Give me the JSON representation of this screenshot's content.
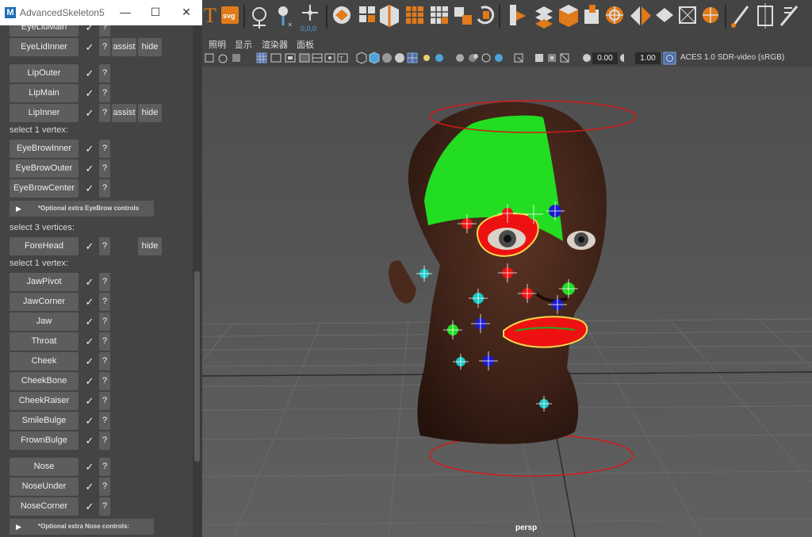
{
  "window": {
    "title": "AdvancedSkeleton5",
    "app_icon_letter": "M",
    "minimize": "—",
    "maximize": "☐",
    "close": "✕"
  },
  "panel": {
    "check_glyph": "✓",
    "q_label": "?",
    "assist_label": "assist",
    "hide_label": "hide",
    "rows": [
      {
        "type": "control",
        "name": "EyeLidMain"
      },
      {
        "type": "control",
        "name": "EyeLidInner",
        "assist": true,
        "hide": true
      },
      {
        "type": "control",
        "name": "LipOuter"
      },
      {
        "type": "control",
        "name": "LipMain"
      },
      {
        "type": "control",
        "name": "LipInner",
        "assist": true,
        "hide": true
      },
      {
        "type": "label",
        "text": "select 1 vertex:"
      },
      {
        "type": "control",
        "name": "EyeBrowInner"
      },
      {
        "type": "control",
        "name": "EyeBrowOuter"
      },
      {
        "type": "control",
        "name": "EyeBrowCenter"
      },
      {
        "type": "optional",
        "text": "*Optional extra EyeBrow controls"
      },
      {
        "type": "label",
        "text": "select 3 vertices:"
      },
      {
        "type": "control",
        "name": "ForeHead",
        "hide": true
      },
      {
        "type": "label",
        "text": "select 1 vertex:"
      },
      {
        "type": "control",
        "name": "JawPivot"
      },
      {
        "type": "control",
        "name": "JawCorner"
      },
      {
        "type": "control",
        "name": "Jaw"
      },
      {
        "type": "control",
        "name": "Throat"
      },
      {
        "type": "control",
        "name": "Cheek"
      },
      {
        "type": "control",
        "name": "CheekBone"
      },
      {
        "type": "control",
        "name": "CheekRaiser"
      },
      {
        "type": "control",
        "name": "SmileBulge"
      },
      {
        "type": "control",
        "name": "FrownBulge"
      },
      {
        "type": "control",
        "name": "Nose"
      },
      {
        "type": "control",
        "name": "NoseUnder"
      },
      {
        "type": "control",
        "name": "NoseCorner"
      },
      {
        "type": "optional",
        "text": "*Optional extra Nose controls:"
      }
    ]
  },
  "menubar": {
    "items": [
      "照明",
      "显示",
      "渲染器",
      "面板"
    ]
  },
  "viewbar": {
    "exposure": "0.00",
    "gamma": "1.00",
    "colorspace": "ACES 1.0 SDR-video (sRGB)"
  },
  "shelf": {
    "svg_label": "svg",
    "coords_label": "0,0,0",
    "t_label": "T",
    "icons": [
      "text-icon",
      "svg-icon",
      "joint-icon",
      "move-joint-icon",
      "origin-icon",
      "shape-icon",
      "cubes-icon",
      "split-cube-icon",
      "grid-cube-icon",
      "grid-icon",
      "swap-icon",
      "cycle-icon",
      "mirror-icon",
      "stack-icon",
      "box-icon",
      "puzzle-icon",
      "target-icon",
      "mirror-cube-icon",
      "diamond-icon",
      "frame-icon",
      "sphere-icon",
      "paint-icon",
      "bracket-icon",
      "brush-icon"
    ]
  },
  "viewport": {
    "camera_label": "persp"
  },
  "colors": {
    "accent_green": "#22dd22",
    "accent_red": "#ee1111",
    "marker_blue": "#1a1ad0",
    "marker_cyan": "#19c6c6"
  }
}
